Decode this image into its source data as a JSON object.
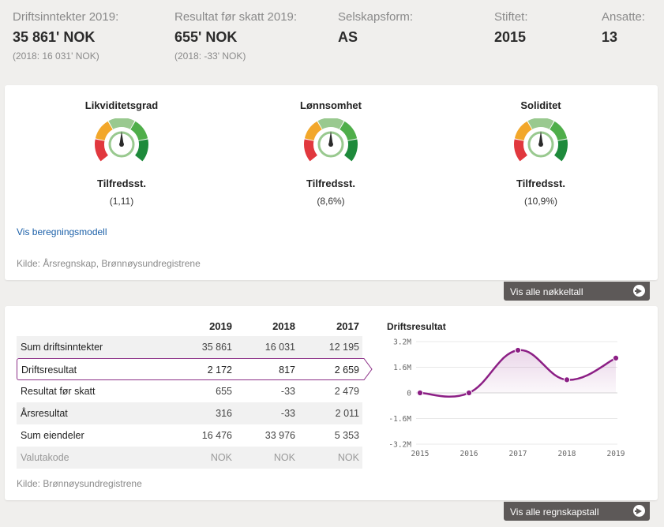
{
  "stats": [
    {
      "label": "Driftsinntekter 2019:",
      "value": "35 861' NOK",
      "sub": "(2018: 16 031' NOK)"
    },
    {
      "label": "Resultat før skatt 2019:",
      "value": "655' NOK",
      "sub": "(2018: -33' NOK)"
    },
    {
      "label": "Selskapsform:",
      "value": "AS"
    },
    {
      "label": "Stiftet:",
      "value": "2015"
    },
    {
      "label": "Ansatte:",
      "value": "13"
    }
  ],
  "gauges": [
    {
      "title": "Likviditetsgrad",
      "status": "Tilfredsst.",
      "value": "(1,11)",
      "level": "satisfactory"
    },
    {
      "title": "Lønnsomhet",
      "status": "Tilfredsst.",
      "value": "(8,6%)",
      "level": "satisfactory"
    },
    {
      "title": "Soliditet",
      "status": "Tilfredsst.",
      "value": "(10,9%)",
      "level": "satisfactory"
    }
  ],
  "gauge_colors": {
    "red": "#e1383e",
    "orange": "#f2a72a",
    "lightgreen": "#99c98f",
    "green": "#4fae4a",
    "darkgreen": "#1e8a3b",
    "needle": "#2b2b2b"
  },
  "calc_link": "Vis beregningsmodell",
  "source1": "Kilde: Årsregnskap, Brønnøysundregistrene",
  "btn_keyfigures": "Vis alle nøkkeltall",
  "table": {
    "headers": [
      "",
      "2019",
      "2018",
      "2017"
    ],
    "rows": [
      [
        "Sum driftsinntekter",
        "35 861",
        "16 031",
        "12 195"
      ],
      [
        "Driftsresultat",
        "2 172",
        "817",
        "2 659"
      ],
      [
        "Resultat før skatt",
        "655",
        "-33",
        "2 479"
      ],
      [
        "Årsresultat",
        "316",
        "-33",
        "2 011"
      ],
      [
        "Sum eiendeler",
        "16 476",
        "33 976",
        "5 353"
      ],
      [
        "Valutakode",
        "NOK",
        "NOK",
        "NOK"
      ]
    ]
  },
  "source2": "Kilde: Brønnøysundregistrene",
  "btn_accounts": "Vis alle regnskapstall",
  "accent_color": "#8c1f85",
  "chart_data": {
    "type": "line",
    "title": "Driftsresultat",
    "x": [
      "2015",
      "2016",
      "2017",
      "2018",
      "2019"
    ],
    "values": [
      0,
      0,
      2.659,
      0.817,
      2.172
    ],
    "yticks": [
      "3.2M",
      "1.6M",
      "0",
      "-1.6M",
      "-3.2M"
    ],
    "ylim": [
      -3.2,
      3.2
    ],
    "unit": "M",
    "grid": true,
    "legend": "none"
  }
}
